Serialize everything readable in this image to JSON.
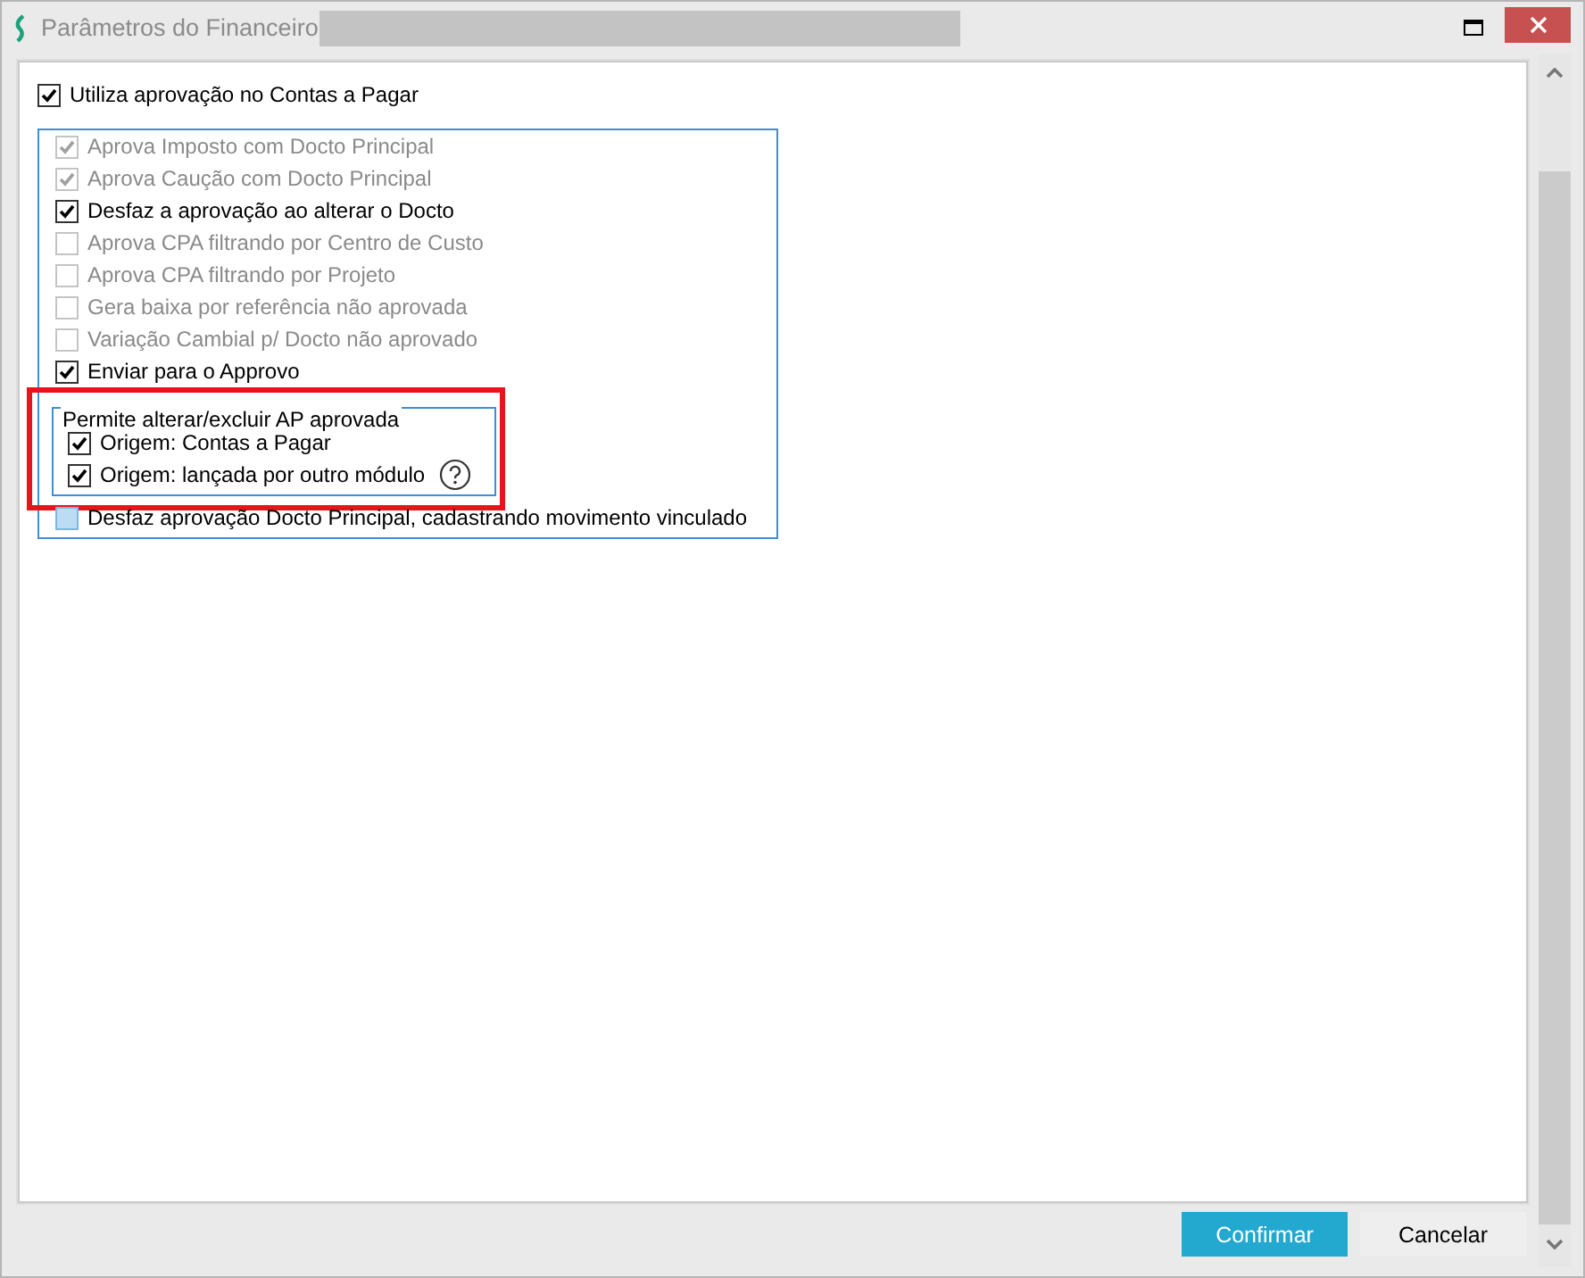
{
  "window": {
    "title": "Parâmetros do Financeiro"
  },
  "main_option": {
    "label": "Utiliza aprovação no Contas a Pagar",
    "checked": true
  },
  "options": [
    {
      "label": "Aprova Imposto com Docto Principal",
      "checked": true,
      "disabled": true,
      "hovered": false
    },
    {
      "label": "Aprova Caução com Docto Principal",
      "checked": true,
      "disabled": true,
      "hovered": false
    },
    {
      "label": "Desfaz a aprovação ao alterar o Docto",
      "checked": true,
      "disabled": false,
      "hovered": false
    },
    {
      "label": "Aprova CPA filtrando por Centro de Custo",
      "checked": false,
      "disabled": true,
      "hovered": false
    },
    {
      "label": "Aprova CPA filtrando por Projeto",
      "checked": false,
      "disabled": true,
      "hovered": false
    },
    {
      "label": "Gera baixa por referência não aprovada",
      "checked": false,
      "disabled": true,
      "hovered": false
    },
    {
      "label": "Variação Cambial p/ Docto não aprovado",
      "checked": false,
      "disabled": true,
      "hovered": false
    },
    {
      "label": "Enviar para o Approvo",
      "checked": true,
      "disabled": false,
      "hovered": false
    }
  ],
  "group": {
    "title": "Permite alterar/excluir AP aprovada",
    "highlighted": true,
    "options": [
      {
        "label": "Origem: Contas a Pagar",
        "checked": true,
        "help": false
      },
      {
        "label": "Origem: lançada por outro módulo",
        "checked": true,
        "help": true
      }
    ]
  },
  "options_after": [
    {
      "label": "Desfaz aprovação Docto Principal, cadastrando movimento vinculado",
      "checked": false,
      "disabled": false,
      "hovered": true
    }
  ],
  "buttons": [
    {
      "label": "Confirmar",
      "kind": "primary"
    },
    {
      "label": "Cancelar",
      "kind": "secondary"
    }
  ]
}
